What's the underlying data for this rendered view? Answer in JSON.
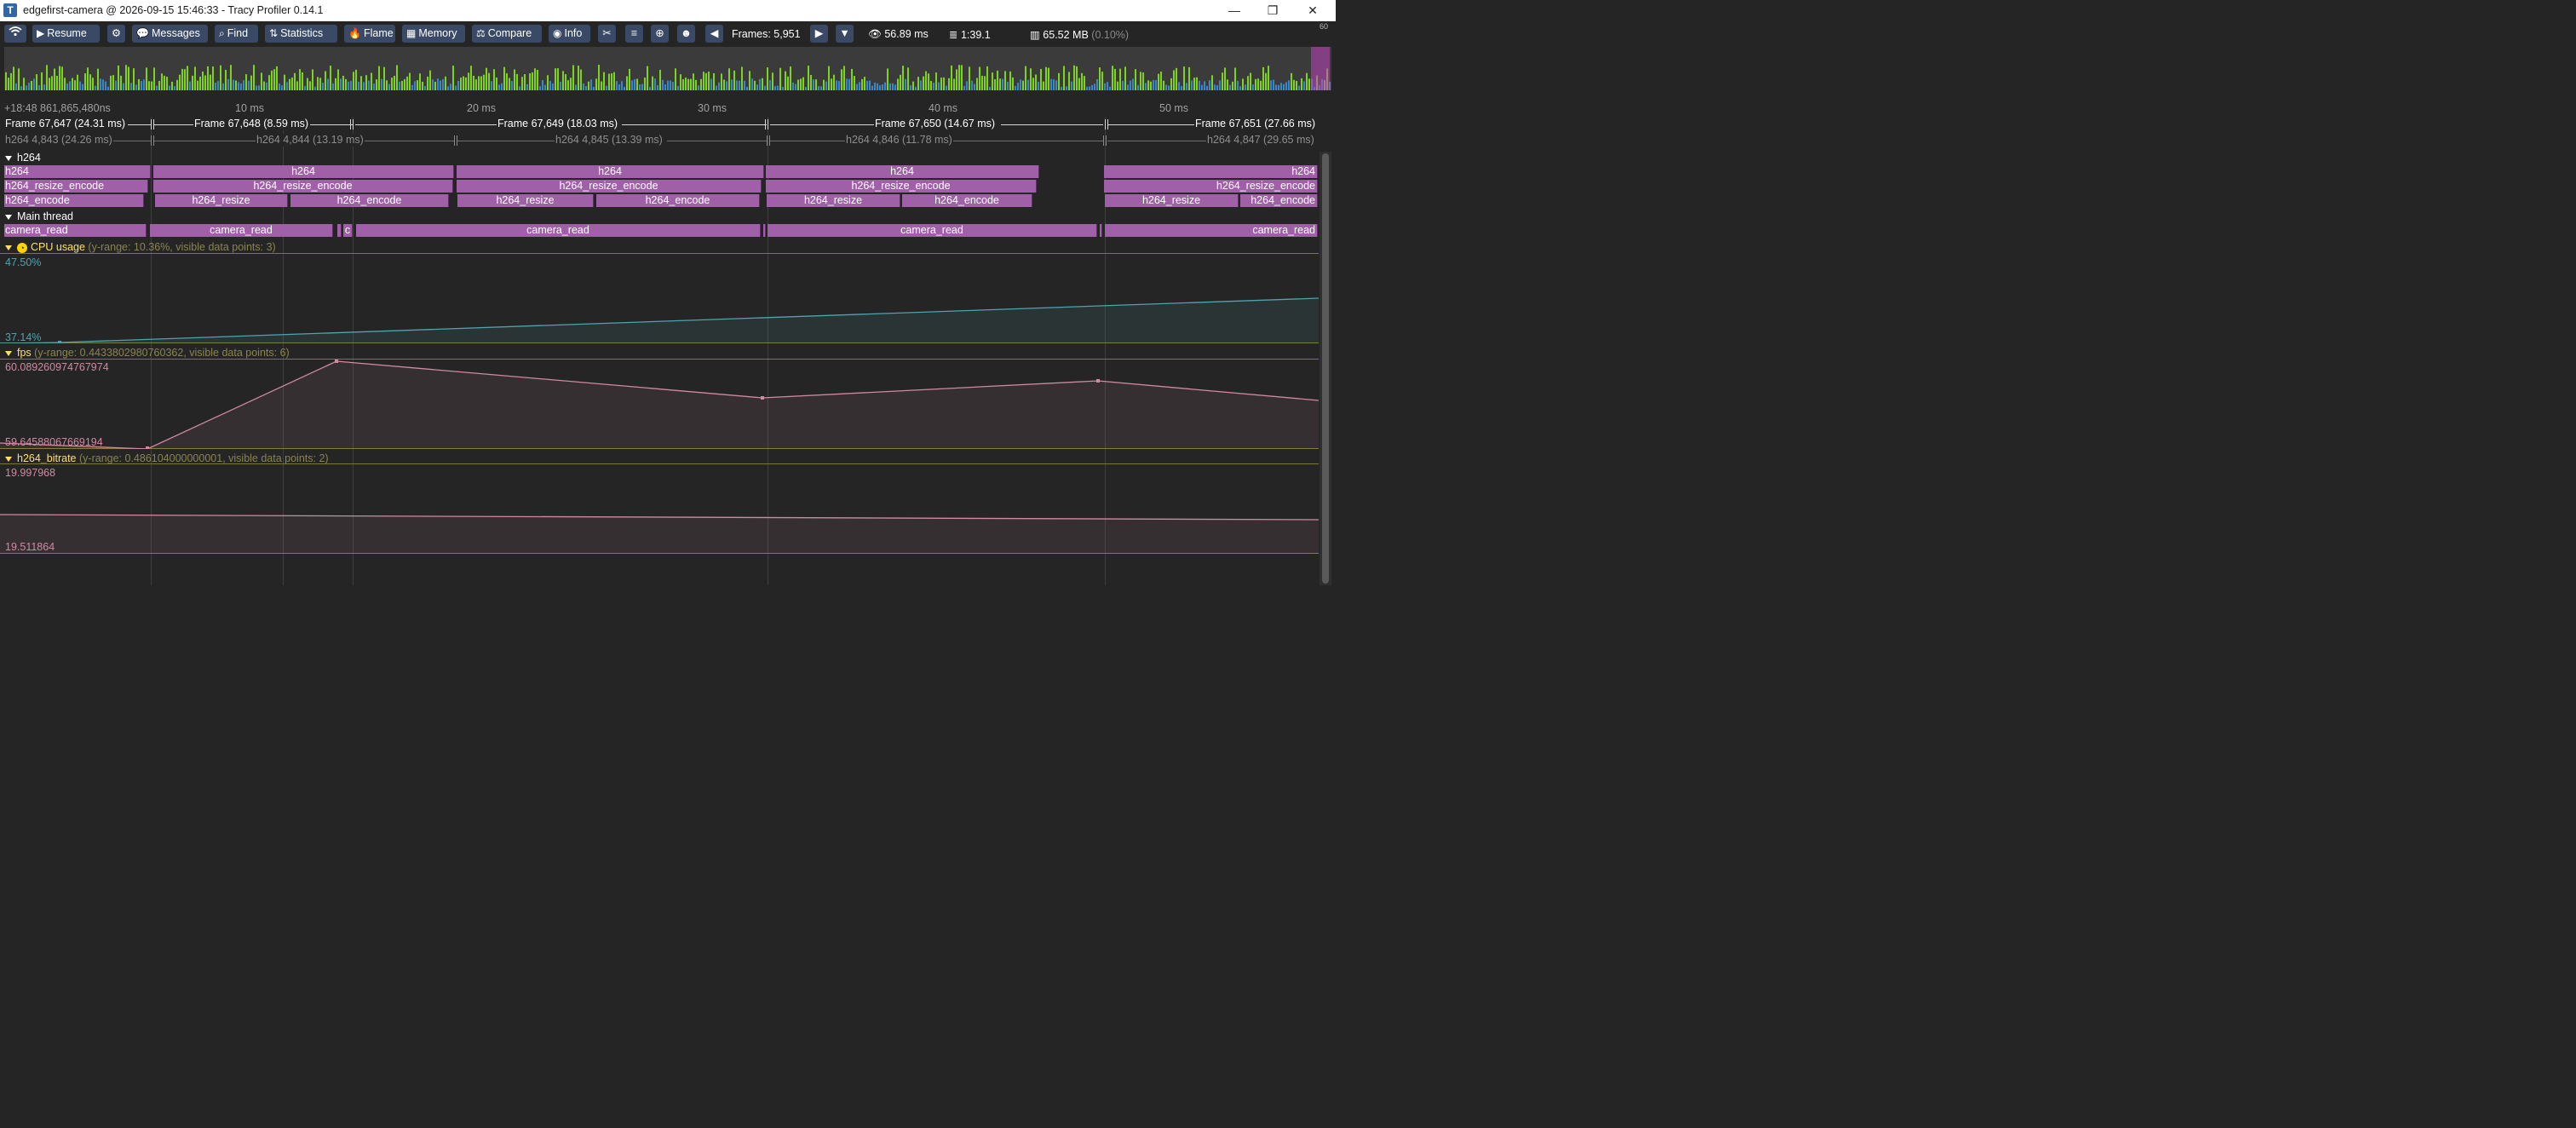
{
  "window": {
    "icon": "T",
    "title": "edgefirst-camera @ 2026-09-15 15:46:33 - Tracy Profiler 0.14.1",
    "minimize": "—",
    "maximize": "❐",
    "close": "✕"
  },
  "toolbar": {
    "connection_icon": "wifi-icon",
    "resume": "Resume",
    "settings_icon": "gear-icon",
    "messages": "Messages",
    "find": "Find",
    "statistics": "Statistics",
    "flame": "Flame",
    "memory": "Memory",
    "compare": "Compare",
    "info": "Info",
    "tools_icon": "tools-icon",
    "notes_icon": "notes-icon",
    "zoom_icon": "magnify-icon",
    "robot_icon": "robot-icon",
    "frames_label": "Frames: 5,951",
    "view_time": "56.89 ms",
    "db_time": "1:39.1",
    "memory_usage": "65.52 MB",
    "memory_pct": "(0.10%)"
  },
  "overview": {
    "scale_label": "60"
  },
  "ruler": {
    "start": "+18:48 861,865,480ns",
    "ticks": [
      "10 ms",
      "20 ms",
      "30 ms",
      "40 ms",
      "50 ms"
    ]
  },
  "frames": [
    "Frame 67,647 (24.31 ms)",
    "Frame 67,648 (8.59 ms)",
    "Frame 67,649 (18.03 ms)",
    "Frame 67,650 (14.67 ms)",
    "Frame 67,651 (27.66 ms)"
  ],
  "h264_frames": [
    "h264 4,843 (24.26 ms)",
    "h264 4,844 (13.19 ms)",
    "h264 4,845 (13.39 ms)",
    "h264 4,846 (11.78 ms)",
    "h264 4,847 (29.65 ms)"
  ],
  "threads": {
    "h264": {
      "name": "h264",
      "row1": [
        "h264",
        "h264",
        "h264",
        "h264",
        "h264"
      ],
      "row2": [
        "h264_resize_encode",
        "h264_resize_encode",
        "h264_resize_encode",
        "h264_resize_encode",
        "h264_resize_encode"
      ],
      "row3": [
        "h264_encode",
        "h264_resize",
        "h264_encode",
        "h264_resize",
        "h264_encode",
        "h264_resize",
        "h264_encode",
        "h264_resize",
        "h264_encode"
      ]
    },
    "main": {
      "name": "Main thread",
      "zones": [
        "camera_read",
        "camera_read",
        "c",
        "camera_read",
        "camera_read",
        "camera_read"
      ]
    }
  },
  "plots": {
    "cpu": {
      "name": "CPU usage",
      "meta": "(y-range: 10.36%, visible data points: 3)",
      "max": "47.50%",
      "min": "37.14%",
      "color": "#4fa3b0"
    },
    "fps": {
      "name": "fps",
      "meta": "(y-range: 0.4433802980760362, visible data points: 6)",
      "max": "60.089260974767974",
      "min": "59.64588067669194",
      "color": "#d08aa0"
    },
    "bitrate": {
      "name": "h264_bitrate",
      "meta": "(y-range: 0.486104000000001, visible data points: 2)",
      "max": "19.997968",
      "min": "19.511864",
      "color": "#d08aa0"
    }
  }
}
